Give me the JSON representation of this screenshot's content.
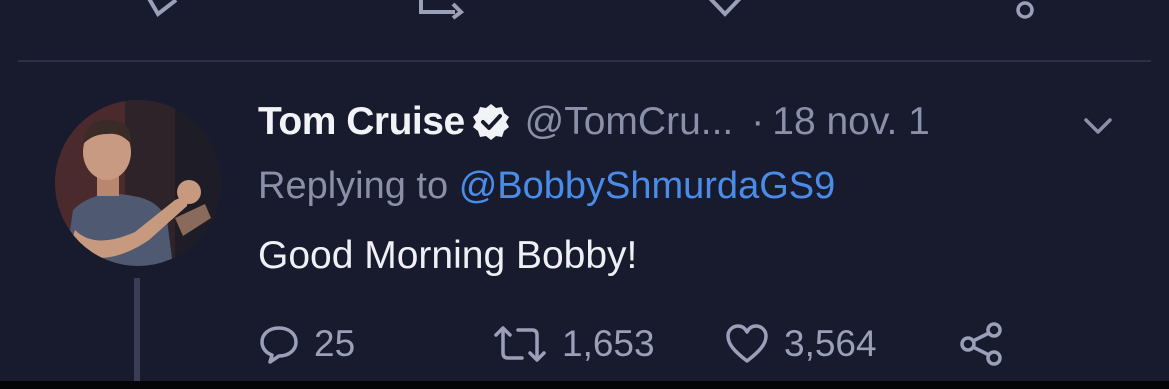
{
  "tweet": {
    "display_name": "Tom Cruise",
    "verified": true,
    "handle": "@TomCru...",
    "separator": "·",
    "date": "18 nov. 1",
    "replying_label": "Replying to",
    "replying_to": "@BobbyShmurdaGS9",
    "text": "Good Morning Bobby!",
    "actions": {
      "replies": "25",
      "retweets": "1,653",
      "likes": "3,564"
    }
  },
  "colors": {
    "background": "#181b2e",
    "muted_text": "#8a90a8",
    "mention_link": "#4a8de8",
    "primary_text": "#eef0f5"
  },
  "icons": [
    "reply-icon",
    "retweet-icon",
    "like-icon",
    "share-icon",
    "verified-badge-icon",
    "chevron-down-icon"
  ]
}
